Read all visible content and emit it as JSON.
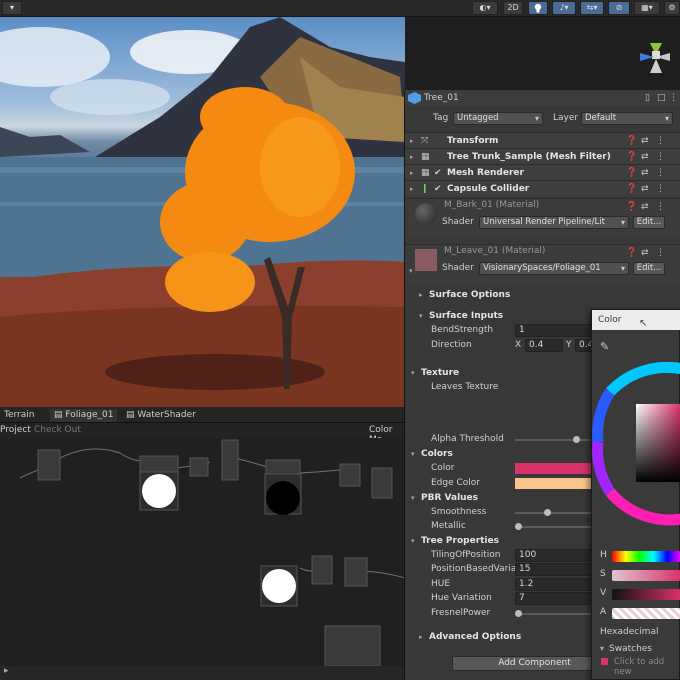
{
  "toolbar": {
    "left_icon": "dropdown-arrow",
    "buttons": [
      {
        "name": "render-mode",
        "label": "◐▾"
      },
      {
        "name": "2d-toggle",
        "label": "2D"
      },
      {
        "name": "lighting",
        "label": "💡"
      },
      {
        "name": "audio",
        "label": "♪▾"
      },
      {
        "name": "effects",
        "label": "⇆▾"
      },
      {
        "name": "hidden-objects",
        "label": "⊘"
      },
      {
        "name": "grid",
        "label": "▦▾"
      },
      {
        "name": "gizmos",
        "label": "⚙"
      }
    ]
  },
  "scene_tabs": [
    {
      "label": "Terrain"
    },
    {
      "label": "Foliage_01",
      "active": true
    },
    {
      "label": "WaterShader"
    }
  ],
  "graph_header": {
    "left": "Project",
    "check_out": "Check Out",
    "right": "Color Mo"
  },
  "inspector": {
    "object_name": "Tree_01",
    "tag_label": "Tag",
    "tag_value": "Untagged",
    "layer_label": "Layer",
    "layer_value": "Default",
    "components": [
      {
        "name": "Transform",
        "checkbox": false
      },
      {
        "name": "Tree Trunk_Sample (Mesh Filter)",
        "checkbox": false
      },
      {
        "name": "Mesh Renderer",
        "checkbox": true
      },
      {
        "name": "Capsule Collider",
        "checkbox": true
      }
    ],
    "materials": [
      {
        "name": "M_Bark_01 (Material)",
        "shader_label": "Shader",
        "shader": "Universal Render Pipeline/Lit",
        "edit": "Edit..."
      },
      {
        "name": "M_Leave_01 (Material)",
        "shader_label": "Shader",
        "shader": "VisionarySpaces/Foliage_01",
        "edit": "Edit..."
      }
    ],
    "sections": {
      "surface_options": "Surface Options",
      "surface_inputs": "Surface Inputs",
      "texture": "Texture",
      "colors": "Colors",
      "pbr": "PBR Values",
      "tree": "Tree Properties",
      "advanced": "Advanced Options"
    },
    "surface_inputs": {
      "bend_label": "BendStrength",
      "bend_value": "1",
      "direction_label": "Direction",
      "dir_x_label": "X",
      "dir_x": "0.4",
      "dir_y_label": "Y",
      "dir_y": "0.4"
    },
    "texture": {
      "leaves_label": "Leaves Texture",
      "alpha_label": "Alpha Threshold",
      "alpha_level": 0.8
    },
    "colors": {
      "color_label": "Color",
      "color_hex": "#d8326a",
      "edge_label": "Edge Color",
      "edge_hex": "#f9c38a"
    },
    "pbr": {
      "smooth_label": "Smoothness",
      "smooth_level": 0.4,
      "metallic_label": "Metallic",
      "metallic_level": 0.0
    },
    "tree": {
      "tiling_label": "TilingOfPosition",
      "tiling": "100",
      "posbased_label": "PositionBasedVariat",
      "posbased": "15",
      "hue_label": "HUE",
      "hue": "1.2",
      "huevar_label": "Hue Variation",
      "huevar": "7",
      "fresnel_label": "FresnelPower",
      "fresnel_level": 0.0
    },
    "add_component": "Add Component"
  },
  "color_picker": {
    "title": "Color",
    "h_label": "H",
    "s_label": "S",
    "v_label": "V",
    "a_label": "A",
    "hex_label": "Hexadecimal",
    "swatches_label": "Swatches",
    "swatch_hint": "Click to add new"
  },
  "colors": {
    "accent": "#4a6d95",
    "panel": "#383838",
    "foliage": "#f58a13"
  }
}
